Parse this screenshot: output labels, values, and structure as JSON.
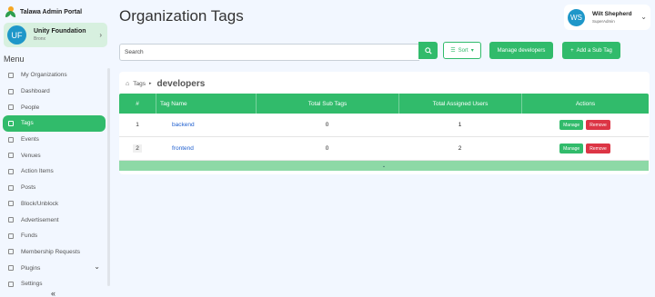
{
  "app": {
    "title": "Talawa Admin Portal"
  },
  "org": {
    "initials": "UF",
    "name": "Unity Foundation",
    "city": "Bronx"
  },
  "sidebar": {
    "menu_label": "Menu",
    "items": [
      {
        "label": "My Organizations",
        "icon": "building-icon"
      },
      {
        "label": "Dashboard",
        "icon": "dashboard-icon"
      },
      {
        "label": "People",
        "icon": "people-icon"
      },
      {
        "label": "Tags",
        "icon": "tag-icon",
        "active": true
      },
      {
        "label": "Events",
        "icon": "calendar-icon"
      },
      {
        "label": "Venues",
        "icon": "location-icon"
      },
      {
        "label": "Action Items",
        "icon": "list-icon"
      },
      {
        "label": "Posts",
        "icon": "posts-icon"
      },
      {
        "label": "Block/Unblock",
        "icon": "block-icon"
      },
      {
        "label": "Advertisement",
        "icon": "ad-icon"
      },
      {
        "label": "Funds",
        "icon": "funds-icon"
      },
      {
        "label": "Membership Requests",
        "icon": "requests-icon"
      },
      {
        "label": "Plugins",
        "icon": "plugin-icon"
      },
      {
        "label": "Settings",
        "icon": "settings-icon"
      }
    ],
    "collapse_glyph": "«"
  },
  "header": {
    "title": "Organization Tags"
  },
  "user": {
    "initials": "WS",
    "name": "Wilt Shepherd",
    "role": "SuperAdmin"
  },
  "toolbar": {
    "search_placeholder": "Search",
    "sort_label": "Sort",
    "manage_developers_label": "Manage developers",
    "add_sub_tag_label": "Add a Sub Tag"
  },
  "breadcrumb": {
    "root": "Tags",
    "current": "developers"
  },
  "table": {
    "headers": {
      "num": "#",
      "name": "Tag Name",
      "sub": "Total Sub Tags",
      "users": "Total Assigned Users",
      "actions": "Actions"
    },
    "rows": [
      {
        "num": "1",
        "name": "backend",
        "sub": "0",
        "users": "1",
        "manage": "Manage",
        "remove": "Remove"
      },
      {
        "num": "2",
        "name": "frontend",
        "sub": "0",
        "users": "2",
        "manage": "Manage",
        "remove": "Remove"
      }
    ],
    "footer_glyph": "⌄"
  },
  "colors": {
    "accent": "#31bb6b",
    "danger": "#dc3545",
    "avatar": "#1e97c9",
    "link": "#1f5fcf"
  }
}
